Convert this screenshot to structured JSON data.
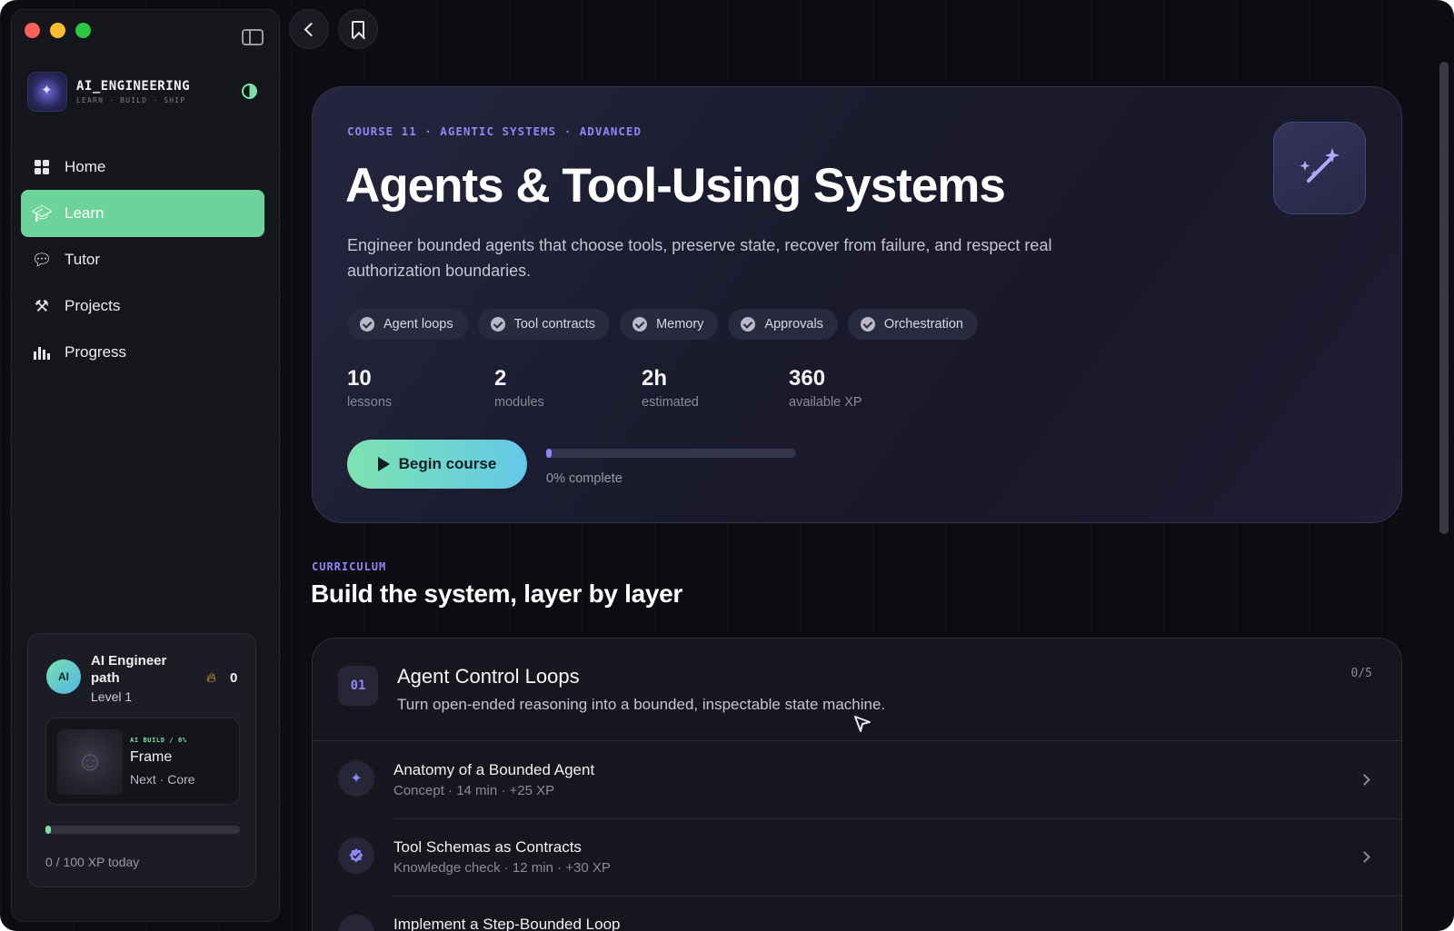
{
  "sidebar": {
    "brand_name": "AI_ENGINEERING",
    "brand_tagline": "LEARN · BUILD · SHIP",
    "nav": [
      {
        "label": "Home",
        "icon": "home-grid-icon"
      },
      {
        "label": "Learn",
        "icon": "graduation-cap-icon",
        "active": true
      },
      {
        "label": "Tutor",
        "icon": "chat-bubbles-icon"
      },
      {
        "label": "Projects",
        "icon": "hammer-icon"
      },
      {
        "label": "Progress",
        "icon": "bar-chart-icon"
      }
    ],
    "path_card": {
      "avatar_text": "AI",
      "title": "AI Engineer path",
      "level": "Level 1",
      "streak": "0",
      "frame_meta": "AI BUILD / 0%",
      "frame_name": "Frame",
      "frame_next": "Next · Core",
      "xp_progress": 0.03,
      "xp_text": "0 / 100 XP today"
    }
  },
  "hero": {
    "kicker": "COURSE 11 · AGENTIC SYSTEMS · ADVANCED",
    "title": "Agents & Tool-Using Systems",
    "description": "Engineer bounded agents that choose tools, preserve state, recover from failure, and respect real authorization boundaries.",
    "tags": [
      "Agent loops",
      "Tool contracts",
      "Memory",
      "Approvals",
      "Orchestration"
    ],
    "stats": [
      {
        "value": "10",
        "label": "lessons"
      },
      {
        "value": "2",
        "label": "modules"
      },
      {
        "value": "2h",
        "label": "estimated"
      },
      {
        "value": "360",
        "label": "available XP"
      }
    ],
    "begin_label": "Begin course",
    "progress": 0.0,
    "progress_text": "0% complete"
  },
  "curriculum": {
    "kicker": "CURRICULUM",
    "title": "Build the system, layer by layer",
    "module": {
      "number": "01",
      "title": "Agent Control Loops",
      "description": "Turn open-ended reasoning into a bounded, inspectable state machine.",
      "count": "0/5",
      "lessons": [
        {
          "title": "Anatomy of a Bounded Agent",
          "meta": "Concept · 14 min · +25 XP"
        },
        {
          "title": "Tool Schemas as Contracts",
          "meta": "Knowledge check · 12 min · +30 XP"
        },
        {
          "title": "Implement a Step-Bounded Loop",
          "meta": ""
        }
      ]
    }
  },
  "colors": {
    "accent_green": "#6cd39a",
    "accent_purple": "#8e86f5",
    "background": "#0c0c12"
  }
}
